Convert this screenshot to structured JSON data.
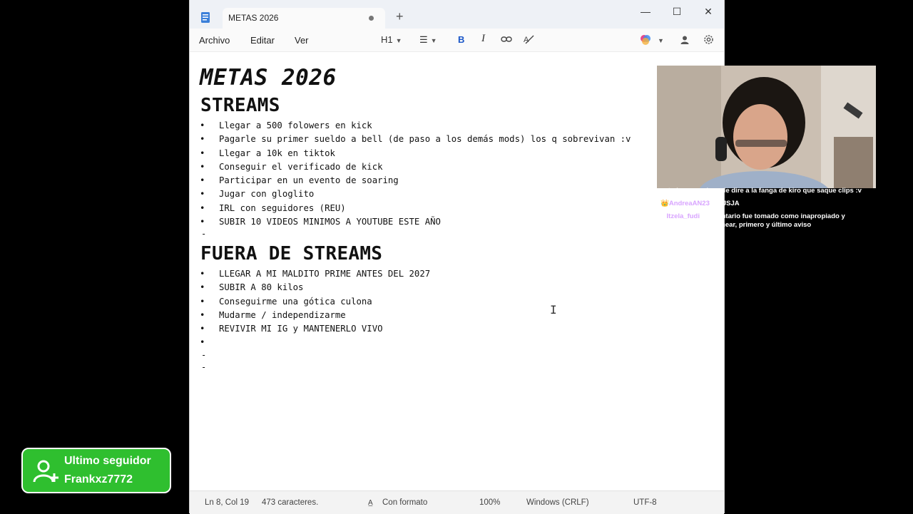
{
  "window": {
    "tab_title": "METAS 2026",
    "new_tab": "+",
    "controls": {
      "minimize": "—",
      "maximize": "☐",
      "close": "✕"
    }
  },
  "menu": {
    "file": "Archivo",
    "edit": "Editar",
    "view": "Ver",
    "heading": "H1",
    "bold": "B",
    "italic": "I"
  },
  "document": {
    "title": "METAS 2026",
    "section1": {
      "heading": "STREAMS",
      "items": [
        "Llegar a 500 folowers en kick",
        "Pagarle su primer sueldo a bell (de paso a los demás mods) los q sobrevivan :v",
        "Llegar a 10k en tiktok",
        "Conseguir el verificado de kick",
        "Participar en un evento de soaring",
        "Jugar con gloglito",
        "IRL con seguidores (REU)",
        "SUBIR 10 VIDEOS MINIMOS A YOUTUBE ESTE AÑO"
      ],
      "trailing": "-"
    },
    "section2": {
      "heading": "FUERA DE STREAMS",
      "items": [
        "LLEGAR A MI MALDITO PRIME ANTES DEL 2027",
        "SUBIR A 80 kilos",
        "Conseguirme una gótica culona",
        "Mudarme / independizarme",
        "REVIVIR MI IG y MANTENERLO VIVO",
        ""
      ],
      "trailing": [
        "-",
        "-"
      ]
    }
  },
  "status": {
    "position": "Ln 8, Col 19",
    "chars": "473 caracteres.",
    "format": "Con formato",
    "zoom": "100%",
    "line_ending": "Windows (CRLF)",
    "encoding": "UTF-8"
  },
  "chat": {
    "messages": [
      {
        "user": "",
        "text": "estado ocupado ya le dire a la fanga de kiro que saque clips :v"
      },
      {
        "user": "AndreaAN23",
        "text": ": JAJSJA"
      },
      {
        "user": "Itzela_fudi",
        "text": ": comentario fue tomado como inapropiado y sigues asi se te Banear, primero y último aviso"
      }
    ]
  },
  "follower": {
    "label": "Ultimo seguidor",
    "name": "Frankxz7772"
  }
}
